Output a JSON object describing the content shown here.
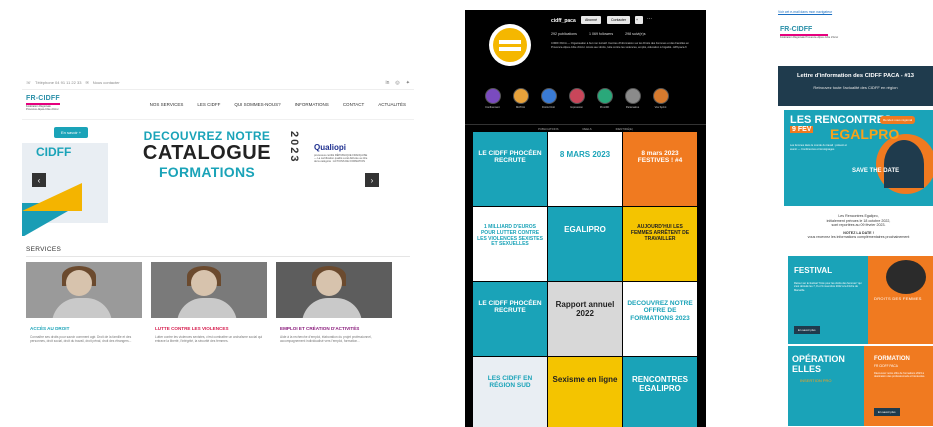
{
  "website": {
    "topbar": {
      "phone": "Téléphone 04 91 11 22 33",
      "contact": "Nous contacter"
    },
    "logo": {
      "name": "FR-CIDFF",
      "tagline": "Fédération Régionale Provence-Alpes-Côte d'Azur"
    },
    "menu": [
      "NOS SERVICES",
      "LES CIDFF",
      "QUI SOMMES-NOUS?",
      "INFORMATIONS",
      "CONTACT",
      "ACTUALITÉS"
    ],
    "hero": {
      "button": "En savoir +",
      "brand": "CIDFF",
      "line1": "DECOUVREZ NOTRE",
      "line2": "CATALOGUE",
      "line3": "FORMATIONS",
      "year": "2023",
      "qualiopi": "Qualiopi",
      "qualiopi_sub": "processus certifié  RÉPUBLIQUE FRANÇAISE — La certification qualité a été délivrée au titre de la catégorie : ACTIONS DE FORMATION"
    },
    "services_title": "SERVICES",
    "cards": [
      {
        "title": "ACCÈS AU DROIT",
        "desc": "Connaître ses droits pour savoir comment agir. Droit de la famille et des personnes, droit social, droit du travail, droit pénal, droit des étrangers..."
      },
      {
        "title": "LUTTE CONTRE LES VIOLENCES",
        "desc": "Lutter contre les violences sexistes, c'est combattre un archaïsme social qui entrave la liberté, l'intégrité, la sécurité des femmes."
      },
      {
        "title": "EMPLOI ET CRÉATION D'ACTIVITÉS",
        "desc": "Aide à la recherche d'emploi, élaboration du projet professionnel, accompagnement individualisé vers l'emploi, formation..."
      }
    ]
  },
  "instagram": {
    "username": "cidff_paca",
    "buttons": [
      "Abonné",
      "Contacter"
    ],
    "stats": [
      "292 publications",
      "1 069 followers",
      "298 suivi(e)s"
    ],
    "bio": "CIDFF PACA — Organisation à but non lucratif. Centres d'Information sur les Droits des Femmes et des Familles en Provence-Alpes-Côte d'Azur. Accès aux droits, lutte contre les violences, emploi, éducation à l'égalité. cidff-paca.fr",
    "highlights": [
      "Confinement",
      "MATCH",
      "Droits Droit",
      "Impression",
      "ProxiDF",
      "Partenaires",
      "Vos Sprint"
    ],
    "tabs": [
      "PUBLICATIONS",
      "REELS",
      "IDENTIFIÉ(E)"
    ],
    "posts": [
      {
        "text": "LE CIDFF PHOCÉEN RECRUTE",
        "bg": "#1aa3b8",
        "fg": "#ffffff"
      },
      {
        "text": "8 MARS 2023",
        "bg": "#ffffff",
        "fg": "#1aa3b8"
      },
      {
        "text": "8 mars 2023 FESTIVES ! #4",
        "bg": "#f07a20",
        "fg": "#ffffff"
      },
      {
        "text": "1 MILLIARD D'EUROS POUR LUTTER CONTRE LES VIOLENCES SEXISTES ET SEXUELLES",
        "bg": "#ffffff",
        "fg": "#1aa3b8"
      },
      {
        "text": "EGALIPRO",
        "bg": "#1aa3b8",
        "fg": "#ffffff"
      },
      {
        "text": "AUJOURD'HUI LES FEMMES ARRÊTENT DE TRAVAILLER",
        "bg": "#f4c400",
        "fg": "#222222"
      },
      {
        "text": "LE CIDFF PHOCÉEN RECRUTE",
        "bg": "#1aa3b8",
        "fg": "#ffffff"
      },
      {
        "text": "Rapport annuel 2022",
        "bg": "#d8d8d8",
        "fg": "#222222"
      },
      {
        "text": "DECOUVREZ NOTRE OFFRE DE FORMATIONS 2023",
        "bg": "#ffffff",
        "fg": "#1aa3b8"
      },
      {
        "text": "LES CIDFF EN RÉGION SUD",
        "bg": "#e9eef3",
        "fg": "#1aa3b8"
      },
      {
        "text": "Sexisme en ligne",
        "bg": "#f4c400",
        "fg": "#222222"
      },
      {
        "text": "RENCONTRES EGALIPRO",
        "bg": "#1aa3b8",
        "fg": "#ffffff"
      }
    ]
  },
  "newsletter": {
    "view_link": "Voir cet e-mail dans mon navigateur",
    "logo": {
      "name": "FR-CIDFF",
      "tagline": "Fédération Régionale Provence-Alpes-Côte d'Azur"
    },
    "header_title": "Lettre d'information des CIDFF PACA - #13",
    "header_sub": "Retrouvez toute l'actualité des CIDFF en région",
    "egalipro": {
      "line1": "LES RENCONTRES",
      "date": "9 FEV",
      "line2": "EGALPRO",
      "desc": "Les femmes dans le monde du travail : présent et avenir — Conférences et témoignages",
      "save": "SAVE THE DATE",
      "tag": "Rendez-vous régional"
    },
    "para": {
      "line1": "Les Rencontres Egalipro,",
      "line2": "initialement prévues le 18 octobre 2022,",
      "line3": "sont reportées au 09 février 2023.",
      "line4": "NOTEZ LA DATE !",
      "line5": "vous recevrez les informations complémentaires prochainement"
    },
    "festival": {
      "title": "FESTIVAL",
      "desc": "Retour sur le festival \"Ciné pour les droits des femmes\" qui s'est déroulé les 7, 8 et 9 novembre 2022 à la Friche de Marseille.",
      "button": "En savoir plus",
      "right": "DROITS DES FEMMES"
    },
    "operation": {
      "title": "OPÉRATION ELLES",
      "sub": "INSERTION PRO",
      "right_title": "FORMATION",
      "right_sub": "FR CIDFF PACA",
      "right_desc": "Découvrez notre offre de formations 2023 à destination des professionnels et bénévoles.",
      "button": "En savoir plus"
    }
  }
}
